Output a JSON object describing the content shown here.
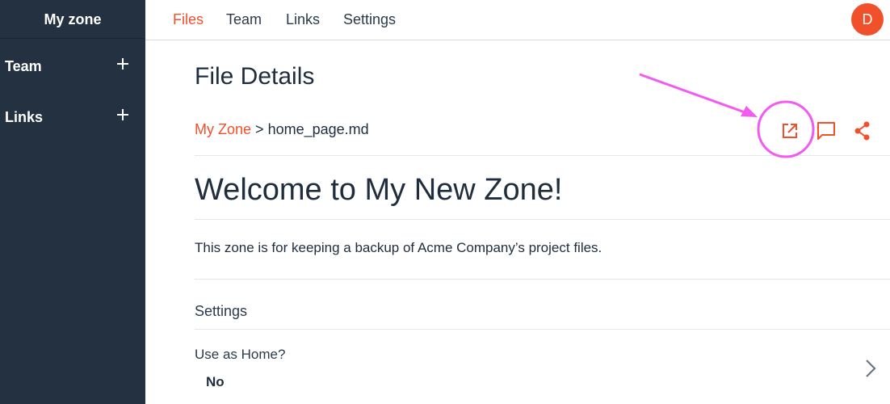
{
  "sidebar": {
    "title": "My zone",
    "items": [
      {
        "label": "Team"
      },
      {
        "label": "Links"
      }
    ]
  },
  "topnav": {
    "tabs": [
      {
        "label": "Files",
        "active": true
      },
      {
        "label": "Team",
        "active": false
      },
      {
        "label": "Links",
        "active": false
      },
      {
        "label": "Settings",
        "active": false
      }
    ],
    "avatar_initial": "D"
  },
  "page": {
    "title": "File Details",
    "breadcrumb": {
      "root": "My Zone",
      "separator": ">",
      "file": "home_page.md"
    },
    "actions": [
      {
        "icon": "open-external-icon"
      },
      {
        "icon": "comment-icon"
      },
      {
        "icon": "share-icon"
      }
    ]
  },
  "document": {
    "heading": "Welcome to My New Zone!",
    "body": "This zone is for keeping a backup of Acme Company’s project files."
  },
  "settings": {
    "section_label": "Settings",
    "rows": [
      {
        "name": "Use as Home?",
        "value": "No"
      }
    ]
  },
  "colors": {
    "accent": "#f0512a",
    "sidebar_bg": "#233141",
    "annotation": "#f25af0"
  }
}
